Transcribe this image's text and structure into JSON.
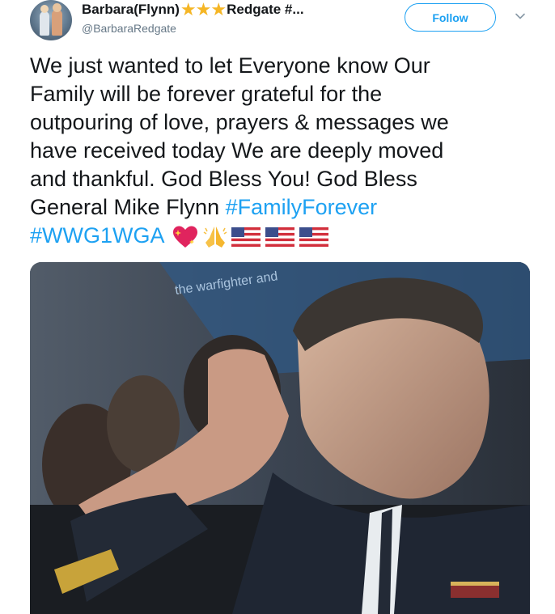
{
  "header": {
    "display_name_prefix": "Barbara(Flynn)",
    "display_name_suffix": "Redgate #...",
    "star_count": 3,
    "handle": "@BarbaraRedgate",
    "follow_label": "Follow",
    "caret_icon": "chevron-down-icon"
  },
  "tweet": {
    "lines": [
      "We just wanted to let Everyone know Our",
      "Family will be forever grateful for the",
      "outpouring of love, prayers & messages we",
      "have received today We are deeply moved",
      "and thankful. God Bless You! God Bless"
    ],
    "line6_text": "General Mike Flynn ",
    "hashtag1": "#FamilyForever",
    "hashtag2": "#WWG1WGA",
    "emojis": [
      "sparkling-heart",
      "folded-hands",
      "us-flag",
      "us-flag",
      "us-flag"
    ]
  },
  "media": {
    "banner_text": "the warfighter and"
  },
  "colors": {
    "link_blue": "#1da1f2",
    "star_gold": "#f5b625",
    "handle_gray": "#657786",
    "text_dark": "#14171a"
  }
}
